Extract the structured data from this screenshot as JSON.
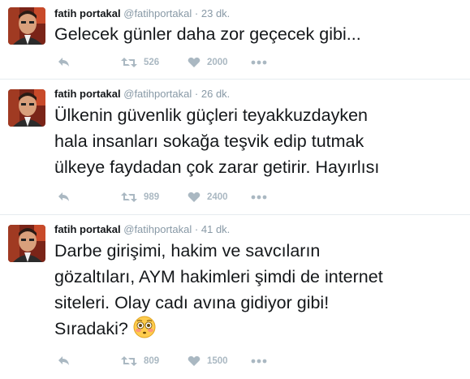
{
  "tweets": [
    {
      "name": "fatih portakal",
      "handle": "@fatihportakal",
      "dot": "·",
      "time": "23 dk.",
      "lines": [
        "Gelecek günler daha zor geçecek gibi..."
      ],
      "retweets": "526",
      "likes": "2000"
    },
    {
      "name": "fatih portakal",
      "handle": "@fatihportakal",
      "dot": "·",
      "time": "26 dk.",
      "lines": [
        "Ülkenin güvenlik güçleri teyakkuzdayken",
        "hala insanları sokağa teşvik edip tutmak",
        "ülkeye faydadan çok zarar getirir. Hayırlısı"
      ],
      "retweets": "989",
      "likes": "2400"
    },
    {
      "name": "fatih portakal",
      "handle": "@fatihportakal",
      "dot": "·",
      "time": "41 dk.",
      "lines": [
        "Darbe girişimi, hakim ve savcıların",
        "gözaltıları, AYM hakimleri şimdi de internet",
        "siteleri. Olay cadı avına gidiyor gibi!",
        "Sıradaki?"
      ],
      "retweets": "809",
      "likes": "1500"
    }
  ],
  "icons": {
    "reply": "reply-icon",
    "retweet": "retweet-icon",
    "like": "heart-icon",
    "more": "more-icon",
    "emoji": "flushed-face-emoji"
  },
  "colors": {
    "action_gray": "#aab8c2",
    "meta_gray": "#8899a6",
    "text": "#14171a",
    "separator": "#e6ecf0"
  }
}
